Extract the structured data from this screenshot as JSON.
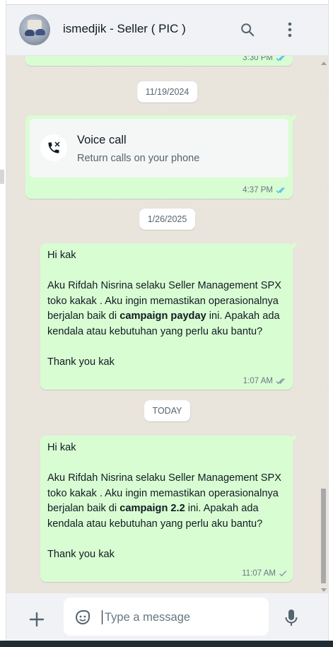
{
  "header": {
    "contact_name": "ismedjik - Seller ( PIC )",
    "avatar_icon": "avatar-photo",
    "search_icon": "search-icon",
    "menu_icon": "kebab-menu-icon"
  },
  "messages": {
    "partial_top": {
      "time": "3:30 PM",
      "status": "read"
    },
    "date1": "11/19/2024",
    "call": {
      "title": "Voice call",
      "subtitle": "Return calls on your phone",
      "time": "4:37 PM",
      "status": "read",
      "icon": "missed-call-icon"
    },
    "date2": "1/26/2025",
    "msg1": {
      "line1": "Hi kak",
      "p_before": "Aku Rifdah Nisrina selaku Seller Management SPX toko kakak . Aku ingin memastikan operasionalnya berjalan baik di ",
      "bold": "campaign payday",
      "p_after": " ini. Apakah ada kendala atau kebutuhan yang perlu aku bantu?",
      "closing": "Thank you kak",
      "time": "1:07 AM",
      "status": "delivered"
    },
    "date3": "TODAY",
    "msg2": {
      "line1": "Hi kak",
      "p_before": "Aku Rifdah Nisrina selaku Seller Management SPX toko kakak . Aku ingin memastikan operasionalnya berjalan baik di ",
      "bold": "campaign 2.2",
      "p_after": " ini. Apakah ada kendala atau kebutuhan yang perlu aku bantu?",
      "closing": "Thank you kak",
      "time": "11:07 AM",
      "status": "sent"
    }
  },
  "footer": {
    "placeholder": "Type a message",
    "value": "",
    "attach_icon": "plus-icon",
    "emoji_icon": "sticker-emoji-icon",
    "mic_icon": "microphone-icon"
  },
  "colors": {
    "outgoing_bubble": "#d9fdd3",
    "chat_background": "#e9e4dc",
    "header_background": "#f0f2f5",
    "read_ticks": "#53bdeb",
    "meta_text": "#667781"
  }
}
